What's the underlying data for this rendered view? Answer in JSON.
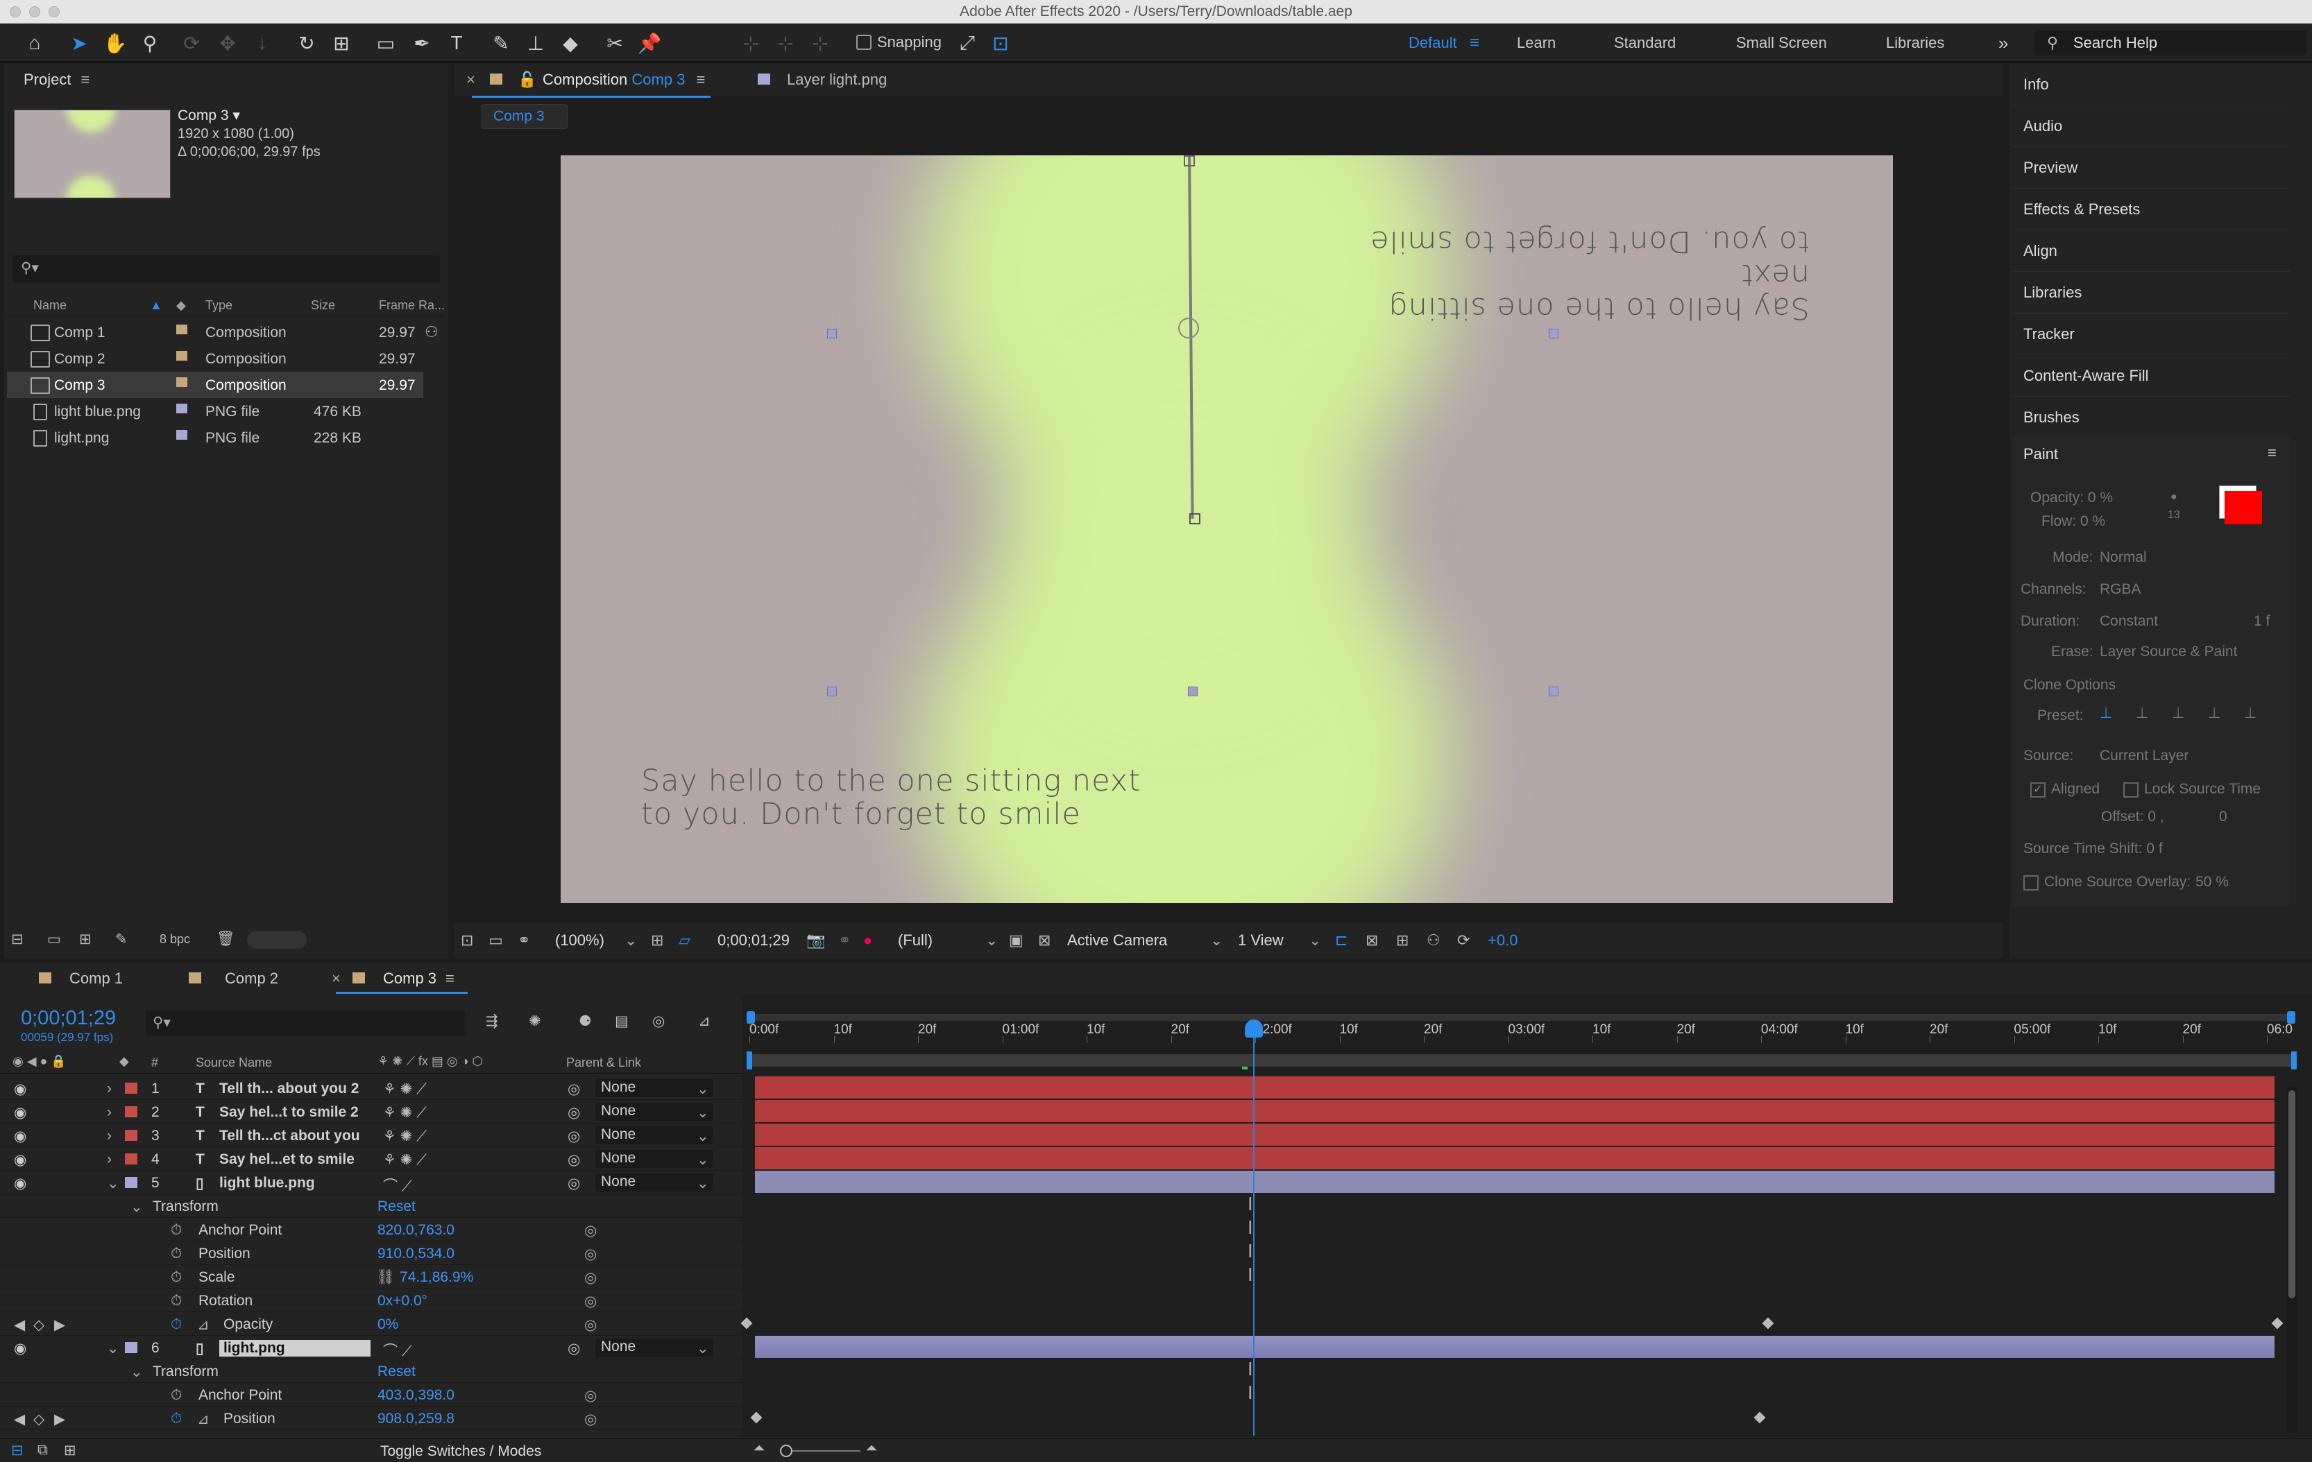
{
  "window": {
    "title": "Adobe After Effects 2020 - /Users/Terry/Downloads/table.aep"
  },
  "toolbar": {
    "snapping_label": "Snapping",
    "workspaces": [
      "Default",
      "Learn",
      "Standard",
      "Small Screen",
      "Libraries"
    ],
    "active_workspace": "Default",
    "search_placeholder": "Search Help"
  },
  "project": {
    "title": "Project",
    "selected_name": "Comp 3",
    "selected_info_1": "1920 x 1080 (1.00)",
    "selected_info_2": "Δ 0;00;06;00, 29.97 fps",
    "columns": {
      "name": "Name",
      "type": "Type",
      "size": "Size",
      "frame_rate": "Frame Ra..."
    },
    "items": [
      {
        "name": "Comp 1",
        "type": "Composition",
        "size": "",
        "fps": "29.97",
        "color": "#c8a87a"
      },
      {
        "name": "Comp 2",
        "type": "Composition",
        "size": "",
        "fps": "29.97",
        "color": "#c8a87a"
      },
      {
        "name": "Comp 3",
        "type": "Composition",
        "size": "",
        "fps": "29.97",
        "color": "#c8a87a"
      },
      {
        "name": "light blue.png",
        "type": "PNG file",
        "size": "476 KB",
        "fps": "",
        "color": "#a9a7d4"
      },
      {
        "name": "light.png",
        "type": "PNG file",
        "size": "228 KB",
        "fps": "",
        "color": "#a9a7d4"
      }
    ],
    "bpc": "8 bpc"
  },
  "viewer": {
    "tab_prefix": "Composition",
    "tab_comp": "Comp 3",
    "layer_tab": "Layer  light.png",
    "breadcrumb": "Comp 3",
    "text_flipped_1": "Say hello to the one sitting next",
    "text_flipped_2": "to you. Don't forget to smile",
    "text_1": "Say hello to the one sitting next",
    "text_2": "to you. Don't forget to smile",
    "zoom": "(100%)",
    "timecode": "0;00;01;29",
    "resolution": "(Full)",
    "camera": "Active Camera",
    "views": "1 View",
    "exposure": "+0.0"
  },
  "right_panels": {
    "items": [
      "Info",
      "Audio",
      "Preview",
      "Effects & Presets",
      "Align",
      "Libraries",
      "Tracker",
      "Content-Aware Fill",
      "Brushes"
    ],
    "paint": {
      "title": "Paint",
      "opacity": "Opacity: 0 %",
      "flow": "Flow: 0 %",
      "brush_size": "13",
      "foreground_color": "#ff0000",
      "background_color": "#ffffff",
      "mode_label": "Mode:",
      "mode_value": "Normal",
      "channels_label": "Channels:",
      "channels_value": "RGBA",
      "duration_label": "Duration:",
      "duration_value": "Constant",
      "duration_frames": "1 f",
      "erase_label": "Erase:",
      "erase_value": "Layer Source & Paint",
      "clone_options": "Clone Options",
      "preset_label": "Preset:",
      "source_label": "Source:",
      "source_value": "Current Layer",
      "aligned": "Aligned",
      "lock_source_time": "Lock Source Time",
      "offset": "Offset: 0 ,",
      "offset_y": "0",
      "source_time_shift": "Source Time Shift: 0  f",
      "clone_source_overlay": "Clone Source Overlay:",
      "overlay_pct": "50 %"
    }
  },
  "timeline": {
    "tabs": [
      "Comp 1",
      "Comp 2",
      "Comp 3"
    ],
    "active_tab": "Comp 3",
    "current_time": "0;00;01;29",
    "current_frame": "00059 (29.97 fps)",
    "columns": {
      "hash": "#",
      "source": "Source Name",
      "parent": "Parent & Link"
    },
    "ruler": [
      "0:00f",
      "10f",
      "20f",
      "01:00f",
      "10f",
      "20f",
      "02:00f",
      "10f",
      "20f",
      "03:00f",
      "10f",
      "20f",
      "04:00f",
      "10f",
      "20f",
      "05:00f",
      "10f",
      "20f",
      "06:0"
    ],
    "layers": [
      {
        "num": "1",
        "icon": "T",
        "name": "Tell th... about you 2",
        "parent": "None",
        "color": "#c84c4c"
      },
      {
        "num": "2",
        "icon": "T",
        "name": "Say hel...t to smile 2",
        "parent": "None",
        "color": "#c84c4c"
      },
      {
        "num": "3",
        "icon": "T",
        "name": "Tell th...ct about you",
        "parent": "None",
        "color": "#c84c4c"
      },
      {
        "num": "4",
        "icon": "T",
        "name": "Say hel...et to smile",
        "parent": "None",
        "color": "#c84c4c"
      },
      {
        "num": "5",
        "icon": "",
        "name": "light blue.png",
        "parent": "None",
        "color": "#a9a7d4"
      }
    ],
    "layer5_props": {
      "transform": "Transform",
      "reset": "Reset",
      "anchor_label": "Anchor Point",
      "anchor_value": "820.0,763.0",
      "position_label": "Position",
      "position_value": "910.0,534.0",
      "scale_label": "Scale",
      "scale_value": "74.1,86.9%",
      "rotation_label": "Rotation",
      "rotation_value": "0x+0.0°",
      "opacity_label": "Opacity",
      "opacity_value": "0%"
    },
    "layer6": {
      "num": "6",
      "name": "light.png",
      "parent": "None"
    },
    "layer6_props": {
      "transform": "Transform",
      "reset": "Reset",
      "anchor_label": "Anchor Point",
      "anchor_value": "403.0,398.0",
      "position_label": "Position",
      "position_value": "908.0,259.8"
    },
    "toggle_label": "Toggle Switches / Modes"
  }
}
